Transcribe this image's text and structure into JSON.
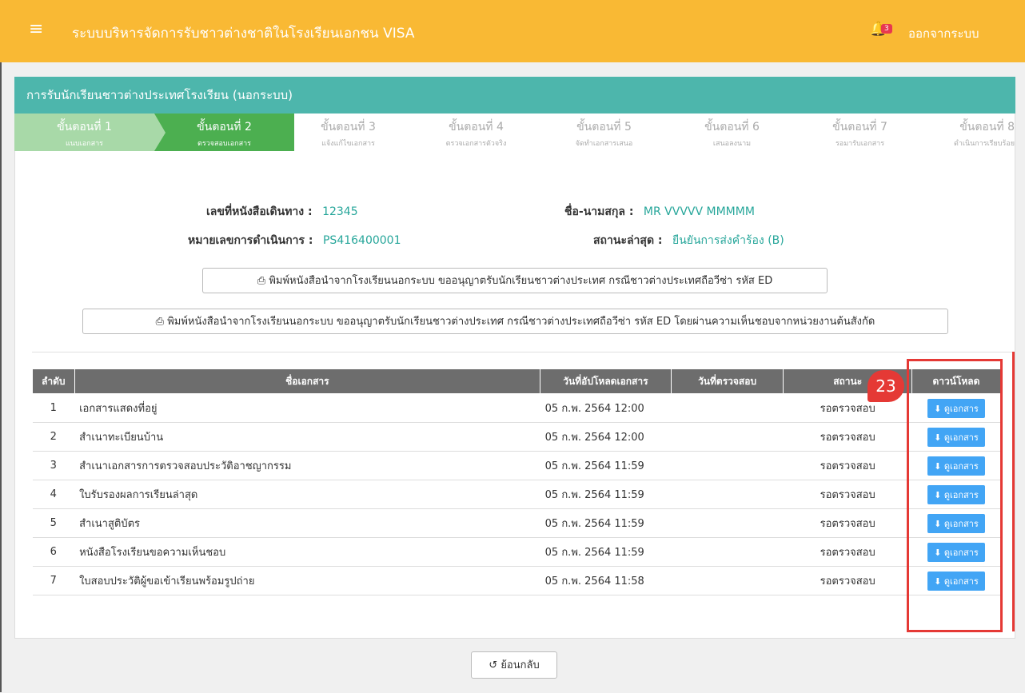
{
  "app": {
    "title": "ระบบบริหารจัดการรับชาวต่างชาติในโรงเรียนเอกชน VISA",
    "notification_count": "3",
    "logout_label": "ออกจากระบบ"
  },
  "panel": {
    "heading": "การรับนักเรียนชาวต่างประเทศโรงเรียน (นอกระบบ)"
  },
  "steps": [
    {
      "label": "ขั้นตอนที่ 1",
      "sub": "แนบเอกสาร"
    },
    {
      "label": "ขั้นตอนที่ 2",
      "sub": "ตรวจสอบเอกสาร"
    },
    {
      "label": "ขั้นตอนที่ 3",
      "sub": "แจ้งแก้ไขเอกสาร"
    },
    {
      "label": "ขั้นตอนที่ 4",
      "sub": "ตรวจเอกสารตัวจริง"
    },
    {
      "label": "ขั้นตอนที่ 5",
      "sub": "จัดทำเอกสารเสนอ"
    },
    {
      "label": "ขั้นตอนที่ 6",
      "sub": "เสนอลงนาม"
    },
    {
      "label": "ขั้นตอนที่ 7",
      "sub": "รอมารับเอกสาร"
    },
    {
      "label": "ขั้นตอนที่ 8",
      "sub": "ดำเนินการเรียบร้อย"
    }
  ],
  "info": {
    "passport_label": "เลขที่หนังสือเดินทาง :",
    "passport_value": "12345",
    "name_label": "ชื่อ-นามสกุล :",
    "name_value": "MR VVVVV MMMMM",
    "process_label": "หมายเลขการดำเนินการ :",
    "process_value": "PS416400001",
    "status_label": "สถานะล่าสุด :",
    "status_value": "ยืนยันการส่งคำร้อง (B)"
  },
  "buttons": {
    "print1": "พิมพ์หนังสือนำจากโรงเรียนนอกระบบ ขออนุญาตรับนักเรียนชาวต่างประเทศ กรณีชาวต่างประเทศถือวีซ่า รหัส ED",
    "print2": "พิมพ์หนังสือนำจากโรงเรียนนอกระบบ ขออนุญาตรับนักเรียนชาวต่างประเทศ กรณีชาวต่างประเทศถือวีซ่า รหัส ED โดยผ่านความเห็นชอบจากหน่วยงานต้นสังกัด",
    "back": "ย้อนกลับ"
  },
  "table": {
    "headers": [
      "ลำดับ",
      "ชื่อเอกสาร",
      "วันที่อัปโหลดเอกสาร",
      "วันที่ตรวจสอบ",
      "สถานะ",
      "ดาวน์โหลด"
    ],
    "rows": [
      {
        "no": "1",
        "name": "เอกสารแสดงที่อยู่",
        "uploaded": "05 ก.พ. 2564 12:00",
        "checked": "",
        "status": "รอตรวจสอบ",
        "action": "ดูเอกสาร"
      },
      {
        "no": "2",
        "name": "สำเนาทะเบียนบ้าน",
        "uploaded": "05 ก.พ. 2564 12:00",
        "checked": "",
        "status": "รอตรวจสอบ",
        "action": "ดูเอกสาร"
      },
      {
        "no": "3",
        "name": "สำเนาเอกสารการตรวจสอบประวัติอาชญากรรม",
        "uploaded": "05 ก.พ. 2564 11:59",
        "checked": "",
        "status": "รอตรวจสอบ",
        "action": "ดูเอกสาร"
      },
      {
        "no": "4",
        "name": "ใบรับรองผลการเรียนล่าสุด",
        "uploaded": "05 ก.พ. 2564 11:59",
        "checked": "",
        "status": "รอตรวจสอบ",
        "action": "ดูเอกสาร"
      },
      {
        "no": "5",
        "name": "สำเนาสูติบัตร",
        "uploaded": "05 ก.พ. 2564 11:59",
        "checked": "",
        "status": "รอตรวจสอบ",
        "action": "ดูเอกสาร"
      },
      {
        "no": "6",
        "name": "หนังสือโรงเรียนขอความเห็นชอบ",
        "uploaded": "05 ก.พ. 2564 11:59",
        "checked": "",
        "status": "รอตรวจสอบ",
        "action": "ดูเอกสาร"
      },
      {
        "no": "7",
        "name": "ใบสอบประวัติผู้ขอเข้าเรียนพร้อมรูปถ่าย",
        "uploaded": "05 ก.พ. 2564 11:58",
        "checked": "",
        "status": "รอตรวจสอบ",
        "action": "ดูเอกสาร"
      }
    ]
  },
  "annotation": {
    "marker_number": "23"
  }
}
